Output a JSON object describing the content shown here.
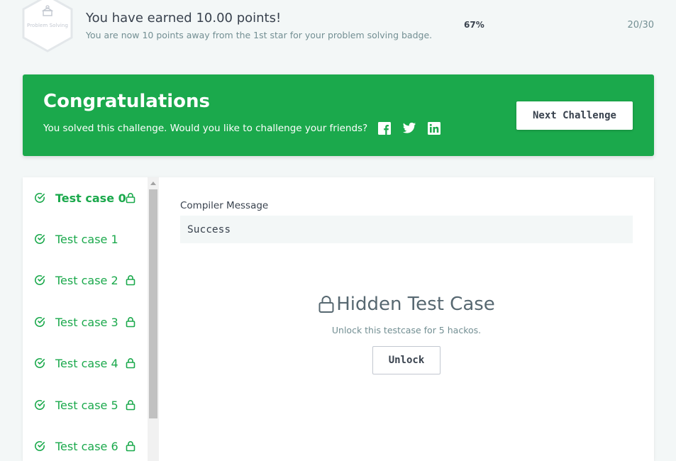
{
  "badge": {
    "label": "Problem Solving",
    "earned_title": "You have earned 10.00 points!",
    "earned_subtitle": "You are now 10 points away from the 1st star for your problem solving badge.",
    "percent": "67%",
    "progress": "20/30",
    "icon": "problem-solving-badge-icon"
  },
  "congrats": {
    "title": "Congratulations",
    "message": "You solved this challenge. Would you like to challenge your friends?",
    "next_label": "Next Challenge",
    "background": "#1ba94c",
    "social": [
      "facebook-icon",
      "twitter-icon",
      "linkedin-icon"
    ]
  },
  "test_cases": [
    {
      "label": "Test case 0",
      "passed": true,
      "locked": true,
      "active": true
    },
    {
      "label": "Test case 1",
      "passed": true,
      "locked": false,
      "active": false
    },
    {
      "label": "Test case 2",
      "passed": true,
      "locked": true,
      "active": false
    },
    {
      "label": "Test case 3",
      "passed": true,
      "locked": true,
      "active": false
    },
    {
      "label": "Test case 4",
      "passed": true,
      "locked": true,
      "active": false
    },
    {
      "label": "Test case 5",
      "passed": true,
      "locked": true,
      "active": false
    },
    {
      "label": "Test case 6",
      "passed": true,
      "locked": true,
      "active": false
    }
  ],
  "compiler": {
    "label": "Compiler Message",
    "message": "Success"
  },
  "hidden": {
    "title": "Hidden Test Case",
    "subtitle": "Unlock this testcase for 5 hackos.",
    "unlock_label": "Unlock"
  },
  "colors": {
    "accent": "#1ba94c",
    "text": "#39424e",
    "muted": "#738f93"
  }
}
